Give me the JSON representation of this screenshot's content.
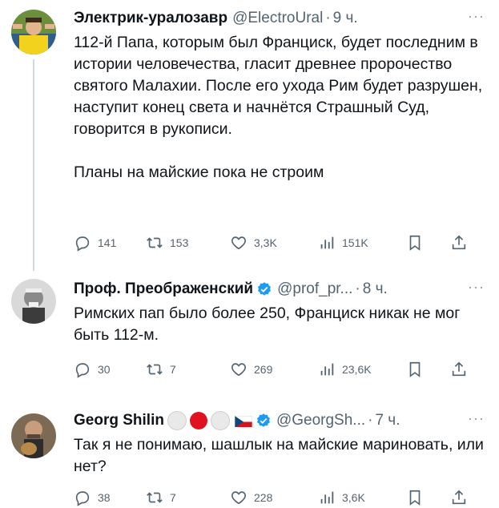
{
  "tweets": [
    {
      "name": "Электрик-уралозавр",
      "handle": "@ElectroUral",
      "dot": "·",
      "time": "9 ч.",
      "more": "···",
      "text": "112-й Папа, которым был Франциск, будет последним в истории человечества, гласит древнее пророчество святого Малахии. После его ухода Рим будет разрушен, наступит конец света и начнётся Страшный Суд, говорится в рукописи.\n\nПланы на майские пока не строим",
      "replies": "141",
      "retweets": "153",
      "likes": "3,3K",
      "views": "151K"
    },
    {
      "name": "Проф. Преображенский",
      "handle": "@prof_pr...",
      "dot": "·",
      "time": "8 ч.",
      "more": "···",
      "text": "Римских пап было более 250, Франциск никак не мог быть 112-м.",
      "replies": "30",
      "retweets": "7",
      "likes": "269",
      "views": "23,6K"
    },
    {
      "name": "Georg Shilin",
      "handle": "@GeorgSh...",
      "dot": "·",
      "time": "7 ч.",
      "more": "···",
      "text": "Так я не понимаю, шашлык на майские мариновать, или нет?",
      "replies": "38",
      "retweets": "7",
      "likes": "228",
      "views": "3,6K"
    }
  ],
  "icons": {
    "reply": "reply-icon",
    "retweet": "retweet-icon",
    "like": "like-icon",
    "views": "views-icon",
    "bookmark": "bookmark-icon",
    "share": "share-icon",
    "verified": "verified-badge-icon"
  },
  "colors": {
    "text": "#0f1419",
    "secondary": "#536471",
    "verified": "#1d9bf0",
    "thread_line": "#cfd9de",
    "red_circle": "#e0121f"
  }
}
